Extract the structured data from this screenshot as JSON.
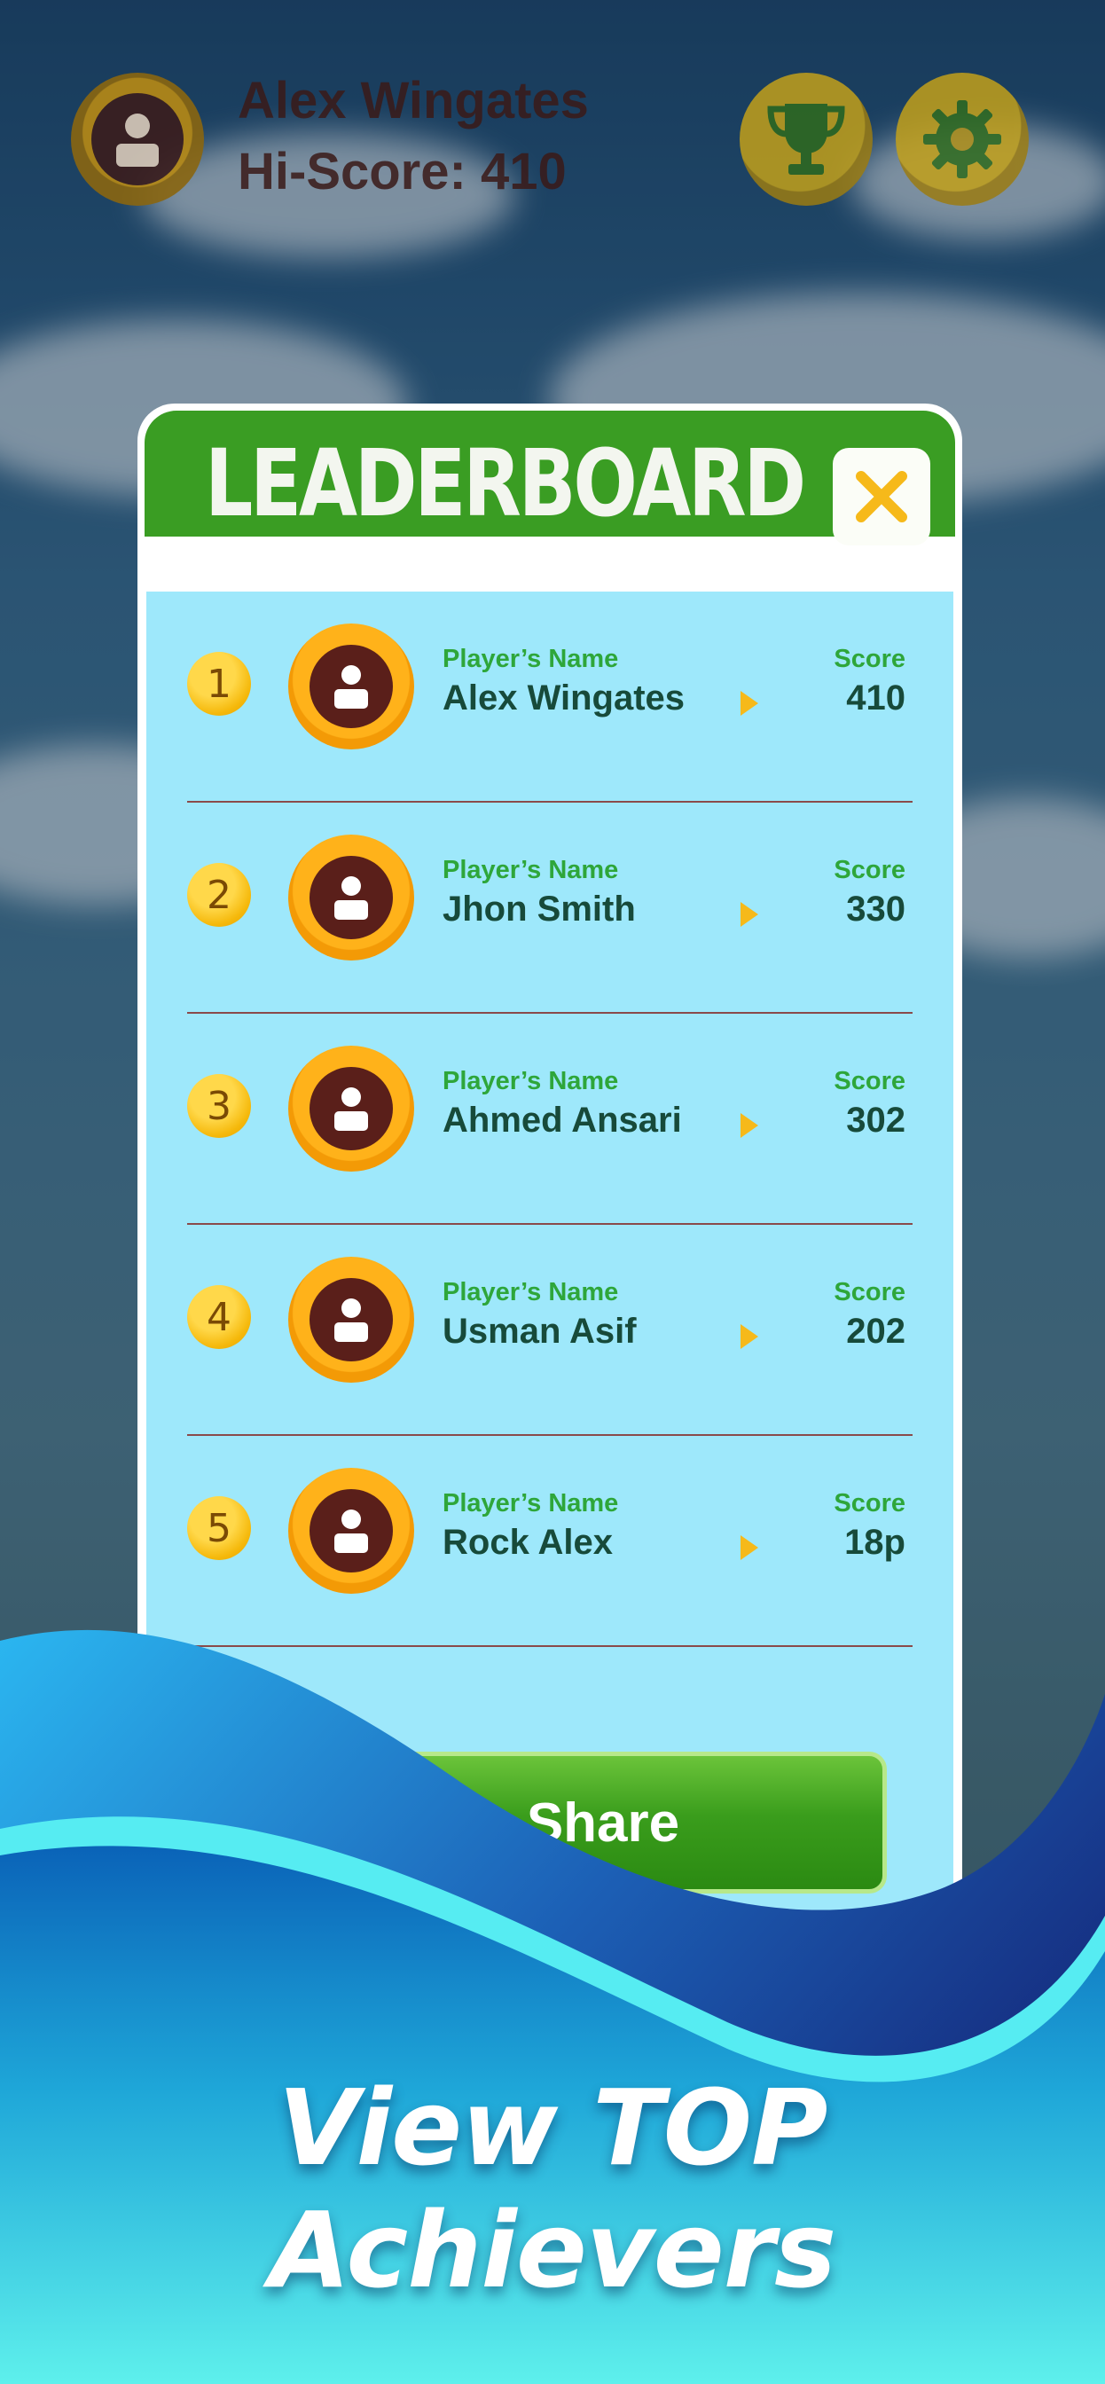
{
  "header": {
    "player_name": "Alex Wingates",
    "hi_score": "Hi-Score: 410"
  },
  "modal": {
    "title": "LEADERBOARD",
    "name_label": "Player’s Name",
    "score_label": "Score",
    "rows": [
      {
        "rank": "1",
        "name": "Alex Wingates",
        "score": "410"
      },
      {
        "rank": "2",
        "name": "Jhon Smith",
        "score": "330"
      },
      {
        "rank": "3",
        "name": "Ahmed Ansari",
        "score": "302"
      },
      {
        "rank": "4",
        "name": "Usman Asif",
        "score": "202"
      },
      {
        "rank": "5",
        "name": "Rock Alex",
        "score": "18p"
      }
    ],
    "share_label": "Share"
  },
  "banner": {
    "text": "View TOP Achievers"
  },
  "icons": {
    "close": "close-icon",
    "trophy": "trophy-icon",
    "settings": "gear-icon",
    "avatar": "user-icon",
    "row_arrow": "play-arrow-icon"
  },
  "colors": {
    "header_green": "#3a9d23",
    "modal_body": "#9ee8fb",
    "label_green": "#2ea63a",
    "value_dark": "#174a3a",
    "accent_orange": "#f6b91a"
  }
}
